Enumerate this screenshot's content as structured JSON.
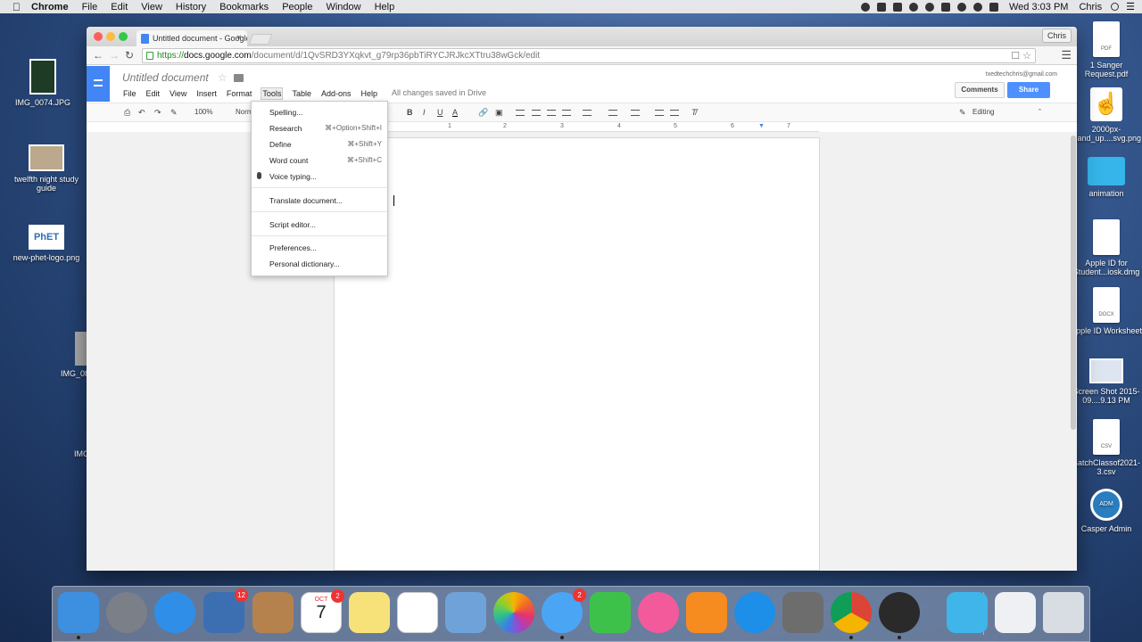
{
  "menubar": {
    "app": "Chrome",
    "items": [
      "File",
      "Edit",
      "View",
      "History",
      "Bookmarks",
      "People",
      "Window",
      "Help"
    ],
    "clock": "Wed 3:03 PM",
    "user": "Chris",
    "tray_icons": [
      "screen-record-icon",
      "camera-icon",
      "dropbox-icon",
      "creative-cloud-icon",
      "timemachine-icon",
      "airplay-icon",
      "bluetooth-icon",
      "wifi-icon",
      "battery-icon"
    ]
  },
  "desktop_left": [
    {
      "label": "IMG_0074.JPG"
    },
    {
      "label": "twelfth night study guide"
    },
    {
      "label": "new-phet-logo.png"
    },
    {
      "label": "IMG_08"
    },
    {
      "label": "IMG"
    }
  ],
  "desktop_right": [
    {
      "label": "1 Sanger Request.pdf",
      "tag": "PDF"
    },
    {
      "label": "2000px-Hand_up....svg.png"
    },
    {
      "label": "animation"
    },
    {
      "label": "Apple ID for Student...iosk.dmg"
    },
    {
      "label": "Apple ID Worksheet",
      "tag": "DOCX"
    },
    {
      "label": "Screen Shot 2015-09....9.13 PM"
    },
    {
      "label": "BatchClassof2021-3.csv",
      "tag": "CSV"
    },
    {
      "label": "Casper Admin"
    }
  ],
  "browser": {
    "tab_title": "Untitled document - Google",
    "profile": "Chris",
    "url_scheme": "https://",
    "url_host": "docs.google.com",
    "url_path": "/document/d/1QvSRD3YXqkvt_g79rp36pbTiRYCJRJkcXTtru38wGck/edit"
  },
  "docs": {
    "title": "Untitled document",
    "menu": [
      "File",
      "Edit",
      "View",
      "Insert",
      "Format",
      "Tools",
      "Table",
      "Add-ons",
      "Help"
    ],
    "saved_status": "All changes saved in Drive",
    "account": "txedtechchris@gmail.com",
    "comments": "Comments",
    "share": "Share",
    "zoom": "100%",
    "style": "Norm",
    "mode": "Editing",
    "ruler": [
      "1",
      "2",
      "3",
      "4",
      "5",
      "6",
      "7"
    ]
  },
  "tools_menu": [
    {
      "label": "Spelling...",
      "shortcut": ""
    },
    {
      "label": "Research",
      "shortcut": "⌘+Option+Shift+I"
    },
    {
      "label": "Define",
      "shortcut": "⌘+Shift+Y"
    },
    {
      "label": "Word count",
      "shortcut": "⌘+Shift+C"
    },
    {
      "label": "Voice typing...",
      "shortcut": ""
    },
    {
      "label": "Translate document...",
      "shortcut": ""
    },
    {
      "label": "Script editor...",
      "shortcut": ""
    },
    {
      "label": "Preferences...",
      "shortcut": ""
    },
    {
      "label": "Personal dictionary...",
      "shortcut": ""
    }
  ],
  "dock": {
    "mail_badge": "12",
    "calendar_month": "OCT",
    "calendar_day": "7",
    "calendar_badge": "2",
    "messages_badge": "2",
    "colors": {
      "finder": "#3d8fe0",
      "launchpad": "#7a7f88",
      "safari": "#2f8fe8",
      "mail": "#3b6fb2",
      "contacts": "#b5824d",
      "calendar": "#ffffff",
      "notes": "#f7e27a",
      "reminders": "#ffffff",
      "preview": "#6fa2d8",
      "photos": "#f0f0f0",
      "messages": "#4aa6f5",
      "facetime": "#3ec14b",
      "itunes": "#f35a9b",
      "ibooks": "#f68b1f",
      "appstore": "#1d8fe8",
      "sysprefs": "#6d6d6d",
      "chrome": "#e8453c",
      "quicktime": "#2a2a2a",
      "downloads": "#3fb5ea",
      "trash": "#d8dde3"
    }
  }
}
